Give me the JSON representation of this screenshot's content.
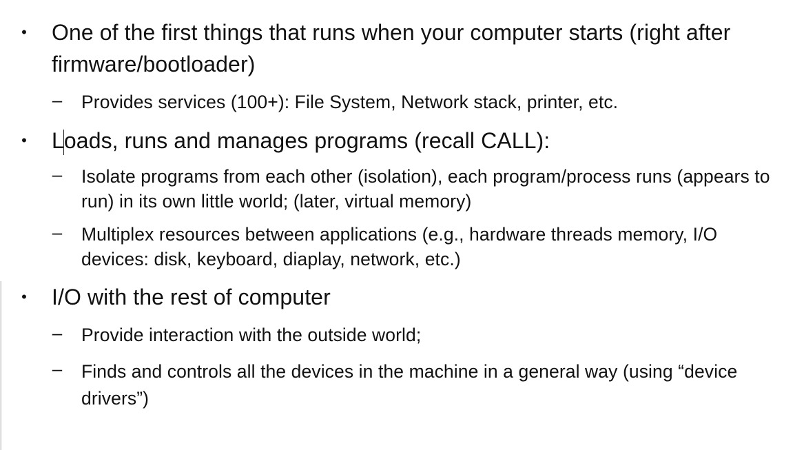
{
  "slide": {
    "bullets": [
      {
        "marker": "•",
        "text": "One of the first things that runs when your computer starts (right after firmware/bootloader)",
        "sub": [
          {
            "marker": "–",
            "text": "Provides services (100+): File System, Network stack, printer, etc."
          }
        ]
      },
      {
        "marker": "•",
        "text": "Loads, runs and manages programs (recall CALL):",
        "sub": [
          {
            "marker": "–",
            "text": "Isolate programs from each other (isolation), each program/process runs (appears to run) in its own little world; (later, virtual memory)"
          },
          {
            "marker": "–",
            "text": "Multiplex resources between applications (e.g., hardware threads memory, I/O devices: disk, keyboard, diaplay, network, etc.)"
          }
        ]
      },
      {
        "marker": "•",
        "text": "I/O with the rest of computer",
        "sub": [
          {
            "marker": "–",
            "text": "Provide interaction with the outside world;"
          },
          {
            "marker": "–",
            "text": "Finds and controls all the devices in the machine in a general way (using “device drivers”)"
          }
        ]
      }
    ]
  }
}
